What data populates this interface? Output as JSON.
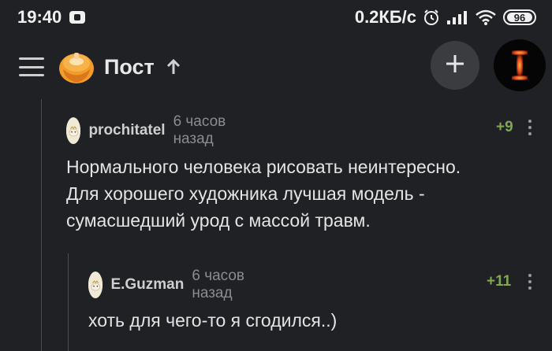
{
  "status_bar": {
    "time": "19:40",
    "network_speed": "0.2КБ/с",
    "battery_level": "96",
    "icons": [
      "app-notification-icon",
      "alarm-icon",
      "signal-icon",
      "wifi-icon",
      "battery-icon"
    ]
  },
  "header": {
    "title": "Пост",
    "icons": [
      "menu-icon",
      "logo-icon",
      "up-arrow-icon",
      "add-icon",
      "avatar"
    ]
  },
  "comments": [
    {
      "author": "prochitatel",
      "time": "6 часов назад",
      "rating": "+9",
      "text": "Нормального человека рисовать неинтересно.\nДля хорошего художника лучшая модель -\nсумасшедший урод с массой травм."
    },
    {
      "author": "E.Guzman",
      "time": "6 часов назад",
      "rating": "+11",
      "text": "хоть для чего-то я сгодился..)"
    }
  ],
  "colors": {
    "background": "#1f2124",
    "rating_green": "#7fa850",
    "muted_text": "#8a8c90",
    "logo_orange": "#f39c2b"
  }
}
